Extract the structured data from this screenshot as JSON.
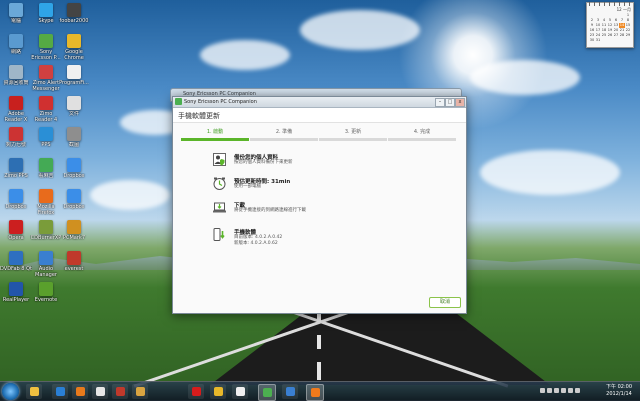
{
  "desktop": {
    "icons": [
      {
        "label": "電腦",
        "color": "#6aa8d8"
      },
      {
        "label": "Skype",
        "color": "#2fa4e7"
      },
      {
        "label": "foobar2000",
        "color": "#444444"
      },
      {
        "label": "網路",
        "color": "#5a9ad0"
      },
      {
        "label": "Sony Ericsson P...",
        "color": "#55aa44"
      },
      {
        "label": "Google Chrome",
        "color": "#e8b82a"
      },
      {
        "label": "資源回收筒",
        "color": "#9fb6c8"
      },
      {
        "label": "Zimo Alert Messenger",
        "color": "#d04040"
      },
      {
        "label": "ProgramFi...",
        "color": "#f0f0f0"
      },
      {
        "label": "Adobe Reader X",
        "color": "#c8201e"
      },
      {
        "label": "Zimo Reader 4",
        "color": "#d03030"
      },
      {
        "label": "文件",
        "color": "#e0e0e0"
      },
      {
        "label": "夠力七號",
        "color": "#cc3333"
      },
      {
        "label": "PPS",
        "color": "#2a8fd6"
      },
      {
        "label": "截圖",
        "color": "#8e8e8e"
      },
      {
        "label": "Zimo PPS",
        "color": "#2d6fb3"
      },
      {
        "label": "看麻吉",
        "color": "#44aa55"
      },
      {
        "label": "Dropbox",
        "color": "#3b8ee8"
      },
      {
        "label": "Dropbox",
        "color": "#3b8ee8"
      },
      {
        "label": "Mozilla Firefox",
        "color": "#e86b1c"
      },
      {
        "label": "Dropbox",
        "color": "#3b8ee8"
      },
      {
        "label": "Opera",
        "color": "#cc1f1f"
      },
      {
        "label": "CDBurnerXP",
        "color": "#7a9c3a"
      },
      {
        "label": "PCMark7",
        "color": "#d09020"
      },
      {
        "label": "DVDFab 8 Qt",
        "color": "#2e6fc0"
      },
      {
        "label": "Audio Manager",
        "color": "#3a7fd0"
      },
      {
        "label": "everest",
        "color": "#c0392b"
      },
      {
        "label": "RealPlayer",
        "color": "#2255aa"
      },
      {
        "label": "Evernote",
        "color": "#5aa02c"
      }
    ]
  },
  "calendar": {
    "header": "12 一月",
    "days": [
      "1",
      "2",
      "3",
      "4",
      "5",
      "6",
      "7",
      "8",
      "9",
      "10",
      "11",
      "12",
      "13",
      "14",
      "15",
      "16",
      "17",
      "18",
      "19",
      "20",
      "21",
      "22",
      "23",
      "24",
      "25",
      "26",
      "27",
      "28",
      "29",
      "30",
      "31"
    ],
    "today": "14"
  },
  "back_window": {
    "title": "Sony Ericsson PC Companion"
  },
  "window": {
    "title": "Sony Ericsson PC Companion",
    "heading": "手機軟體更新",
    "controls": {
      "minimize": "–",
      "maximize": "□",
      "close": "x"
    },
    "steps": [
      {
        "label": "1. 啟動",
        "active": true
      },
      {
        "label": "2. 準備",
        "active": false
      },
      {
        "label": "3. 更新",
        "active": false
      },
      {
        "label": "4. 完成",
        "active": false
      }
    ],
    "items": [
      {
        "title": "備份您的個人資料",
        "sub": "按您的個人資料備份下來更新",
        "icon": "person-shield-icon"
      },
      {
        "title": "預估更新時間: 31min",
        "sub": "使用一部電腦",
        "icon": "clock-icon"
      },
      {
        "title": "下載",
        "sub": "將從手機連接的到網路連線進行下載",
        "icon": "laptop-download-icon"
      },
      {
        "title": "手機軟體",
        "sub": "目前版本: 4.0.2.A.0.42\n新版本: 4.0.2.A.0.62",
        "icon": "phone-download-icon"
      }
    ],
    "cancel_label": "取消"
  },
  "taskbar": {
    "buttons": [
      {
        "name": "explorer",
        "color": "#f0c040"
      },
      {
        "name": "ie",
        "color": "#2a7fd4"
      },
      {
        "name": "media-player",
        "color": "#e87a1c"
      },
      {
        "name": "notepad",
        "color": "#e6e6e6"
      },
      {
        "name": "app-red",
        "color": "#c0392b"
      },
      {
        "name": "folder",
        "color": "#d9a441"
      },
      {
        "name": "opera",
        "color": "#d61c1c"
      },
      {
        "name": "chrome",
        "color": "#e8b82a"
      },
      {
        "name": "word",
        "color": "#f0f0f0"
      },
      {
        "name": "sony-ericsson",
        "color": "#4caf50"
      },
      {
        "name": "mail",
        "color": "#3a7fd0"
      },
      {
        "name": "app-orange",
        "color": "#f07a1c"
      }
    ],
    "clock_time": "下午 02:00",
    "clock_date": "2012/1/14"
  }
}
